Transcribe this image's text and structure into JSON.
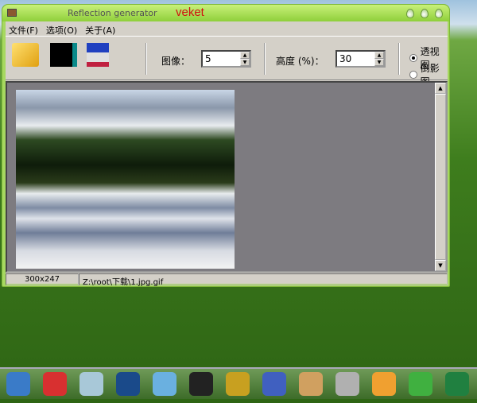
{
  "window": {
    "title": "Reflection generator",
    "brand": "veket"
  },
  "menu": [
    {
      "label": "文件(F)"
    },
    {
      "label": "选项(O)"
    },
    {
      "label": "关于(A)"
    }
  ],
  "toolbar": {
    "image_label": "图像：",
    "image_value": "5",
    "height_label": "高度 (%)：",
    "height_value": "30",
    "radio_perspective": "透视图",
    "radio_reflection": "倒影图",
    "selected": "透视图"
  },
  "status": {
    "size": "300x247",
    "path": "Z:\\root\\下载\\1.jpg.gif"
  },
  "dock": [
    {
      "icon": "computer-icon",
      "color": "#3a7bc8"
    },
    {
      "icon": "pig-icon",
      "color": "#d83030"
    },
    {
      "icon": "notepad-icon",
      "color": "#a8c8d8"
    },
    {
      "icon": "media-player-icon",
      "color": "#1a4a8a"
    },
    {
      "icon": "network-icon",
      "color": "#6ab0e0"
    },
    {
      "icon": "qq-penguin-icon",
      "color": "#222222"
    },
    {
      "icon": "notebook-icon",
      "color": "#c8a020"
    },
    {
      "icon": "chart-icon",
      "color": "#4060c0"
    },
    {
      "icon": "paint-palette-icon",
      "color": "#d0a060"
    },
    {
      "icon": "usb-drive-icon",
      "color": "#b0b0b0"
    },
    {
      "icon": "image-viewer-icon",
      "color": "#f0a030"
    },
    {
      "icon": "help-icon",
      "color": "#40b040"
    },
    {
      "icon": "green-app-icon",
      "color": "#208040"
    }
  ]
}
